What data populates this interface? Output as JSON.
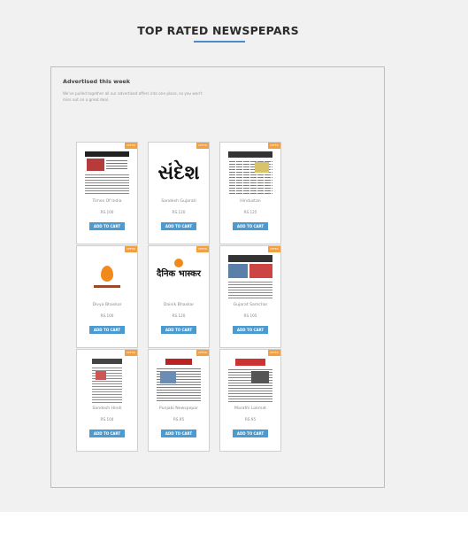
{
  "section": {
    "title": "TOP RATED NEWSPEPARS"
  },
  "panel": {
    "heading": "Advertised this week",
    "description": "We've pulled together all our advertised offers into one place, so you won't miss out on a great deal."
  },
  "products": [
    {
      "name": "Times Of India",
      "price": "RS.100",
      "badge": "OFFER",
      "cart_label": "ADD TO CART",
      "icon": "times-of-india-thumbnail-icon"
    },
    {
      "name": "Sandesh Gujarati",
      "price": "RS.120",
      "badge": "OFFER",
      "cart_label": "ADD TO CART",
      "icon": "sandesh-logo-icon",
      "logo_text": "સંદેશ"
    },
    {
      "name": "Hindustan",
      "price": "RS.125",
      "badge": "OFFER",
      "cart_label": "ADD TO CART",
      "icon": "hindustan-thumbnail-icon"
    },
    {
      "name": "Divya Bhaskar",
      "price": "RS.100",
      "badge": "OFFER",
      "cart_label": "ADD TO CART",
      "icon": "divya-bhaskar-logo-icon"
    },
    {
      "name": "Dainik Bhaskar",
      "price": "RS.120",
      "badge": "OFFER",
      "cart_label": "ADD TO CART",
      "icon": "dainik-bhaskar-logo-icon",
      "logo_text": "दैनिक भास्कर"
    },
    {
      "name": "Gujarat Samchar",
      "price": "RS.105",
      "badge": "OFFER",
      "cart_label": "ADD TO CART",
      "icon": "gujarat-samachar-thumbnail-icon"
    },
    {
      "name": "Sandesh Hindi",
      "price": "RS.104",
      "badge": "OFFER",
      "cart_label": "ADD TO CART",
      "icon": "sandesh-hindi-thumbnail-icon"
    },
    {
      "name": "Punjabi Newspepar",
      "price": "RS.95",
      "badge": "OFFER",
      "cart_label": "ADD TO CART",
      "icon": "punjabi-newspaper-thumbnail-icon"
    },
    {
      "name": "Marathi Lokmat",
      "price": "RS.95",
      "badge": "OFFER",
      "cart_label": "ADD TO CART",
      "icon": "marathi-lokmat-thumbnail-icon"
    }
  ],
  "colors": {
    "accent": "#4b9ad0",
    "offer": "#f2a042",
    "underline": "#4b8cc8"
  }
}
